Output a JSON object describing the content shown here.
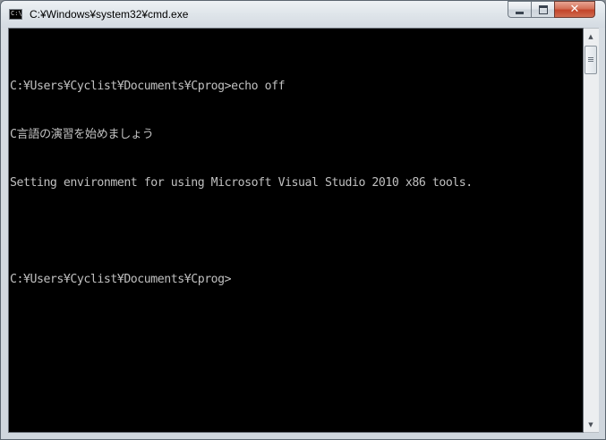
{
  "window": {
    "title": "C:¥Windows¥system32¥cmd.exe",
    "app_icon_label": "C:\\",
    "icon": "cmd-icon"
  },
  "caption_buttons": {
    "minimize_icon": "minimize-icon",
    "maximize_icon": "maximize-icon",
    "close_icon": "close-icon",
    "close_glyph": "✕"
  },
  "console": {
    "background": "#000000",
    "foreground": "#c0c0c0",
    "lines": [
      "C:¥Users¥Cyclist¥Documents¥Cprog>echo off",
      "C言語の演習を始めましょう",
      "Setting environment for using Microsoft Visual Studio 2010 x86 tools.",
      "",
      "C:¥Users¥Cyclist¥Documents¥Cprog>"
    ]
  },
  "scrollbar": {
    "up_arrow": "▲",
    "down_arrow": "▼",
    "position_fraction": 0.0
  }
}
